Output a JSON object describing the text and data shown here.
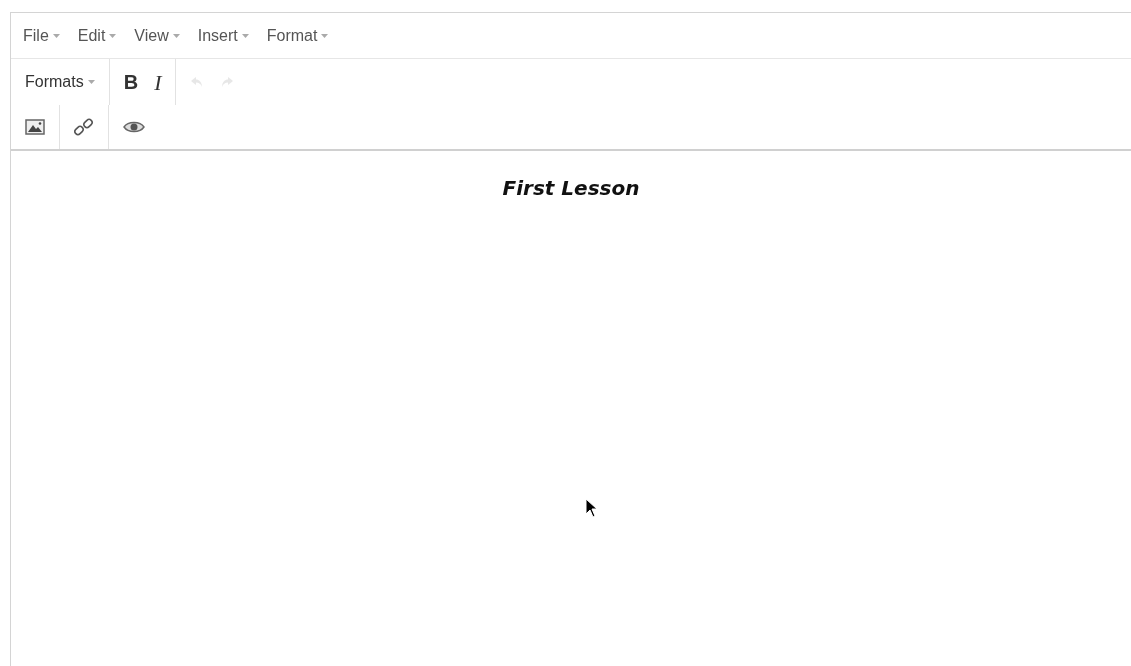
{
  "menubar": [
    {
      "label": "File"
    },
    {
      "label": "Edit"
    },
    {
      "label": "View"
    },
    {
      "label": "Insert"
    },
    {
      "label": "Format"
    }
  ],
  "toolbar_rows": [
    [
      [
        {
          "kind": "dropdown",
          "label": "Formats",
          "disabled": false
        }
      ],
      [
        {
          "kind": "bold",
          "label": "B",
          "disabled": false
        },
        {
          "kind": "italic",
          "label": "I",
          "disabled": false
        }
      ],
      [
        {
          "kind": "undo",
          "disabled": true
        },
        {
          "kind": "redo",
          "disabled": true
        }
      ]
    ],
    [
      [
        {
          "kind": "image",
          "disabled": false
        }
      ],
      [
        {
          "kind": "link",
          "disabled": false
        }
      ],
      [
        {
          "kind": "preview",
          "disabled": false
        }
      ]
    ]
  ],
  "content": {
    "heading": "First Lesson"
  }
}
